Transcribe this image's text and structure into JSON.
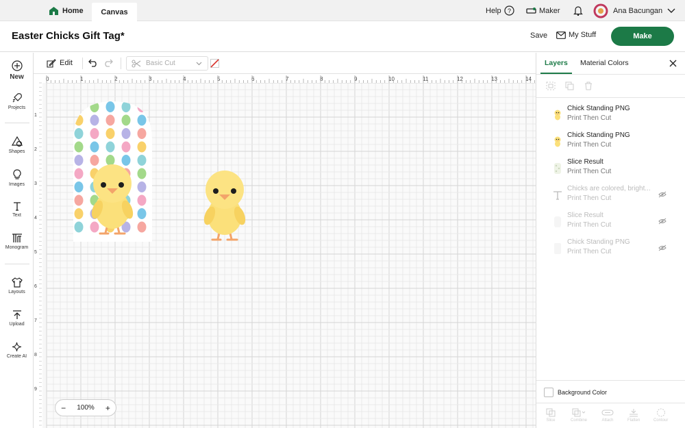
{
  "topbar": {
    "home_label": "Home",
    "canvas_tab": "Canvas",
    "help": "Help",
    "maker": "Maker",
    "user": "Ana Bacungan"
  },
  "project": {
    "title": "Easter Chicks Gift Tag*",
    "save": "Save",
    "my_stuff": "My Stuff",
    "make": "Make"
  },
  "leftbar": {
    "items": [
      {
        "label": "New",
        "icon": "plus-circle-icon"
      },
      {
        "label": "Projects",
        "icon": "rocket-icon"
      },
      {
        "label": "Shapes",
        "icon": "shapes-icon"
      },
      {
        "label": "Images",
        "icon": "bulb-icon"
      },
      {
        "label": "Text",
        "icon": "text-icon"
      },
      {
        "label": "Monogram",
        "icon": "monogram-icon"
      },
      {
        "label": "Layouts",
        "icon": "shirt-icon"
      },
      {
        "label": "Upload",
        "icon": "upload-icon"
      },
      {
        "label": "Create AI",
        "icon": "sparkle-icon"
      }
    ]
  },
  "edit_toolbar": {
    "edit": "Edit",
    "operation": "Basic Cut"
  },
  "ruler": {
    "top": [
      "0",
      "1",
      "2",
      "3",
      "4",
      "5",
      "6",
      "7",
      "8",
      "9",
      "10",
      "11",
      "12",
      "13",
      "14"
    ],
    "left": [
      "1",
      "2",
      "3",
      "4",
      "5",
      "6",
      "7",
      "8",
      "9"
    ]
  },
  "zoom": {
    "value": "100%",
    "minus": "−",
    "plus": "+"
  },
  "panel": {
    "tabs": [
      "Layers",
      "Material Colors"
    ],
    "active_tab": "Layers",
    "layers": [
      {
        "name": "Chick Standing PNG",
        "sub": "Print Then Cut",
        "hidden": false
      },
      {
        "name": "Chick Standing PNG",
        "sub": "Print Then Cut",
        "hidden": false
      },
      {
        "name": "Slice Result",
        "sub": "Print Then Cut",
        "hidden": false
      },
      {
        "name": "Chicks are colored, bright...",
        "sub": "Print Then Cut",
        "hidden": true
      },
      {
        "name": "Slice Result",
        "sub": "Print Then Cut",
        "hidden": true
      },
      {
        "name": "Chick Standing PNG",
        "sub": "Print Then Cut",
        "hidden": true
      }
    ],
    "background_color": "Background Color",
    "bottom_actions": [
      "Slice",
      "Combine",
      "Attach",
      "Flatten",
      "Contour"
    ]
  },
  "colors": {
    "brand": "#1c7a47",
    "accent": "#1c7a47",
    "chick": "#fbe07a"
  }
}
